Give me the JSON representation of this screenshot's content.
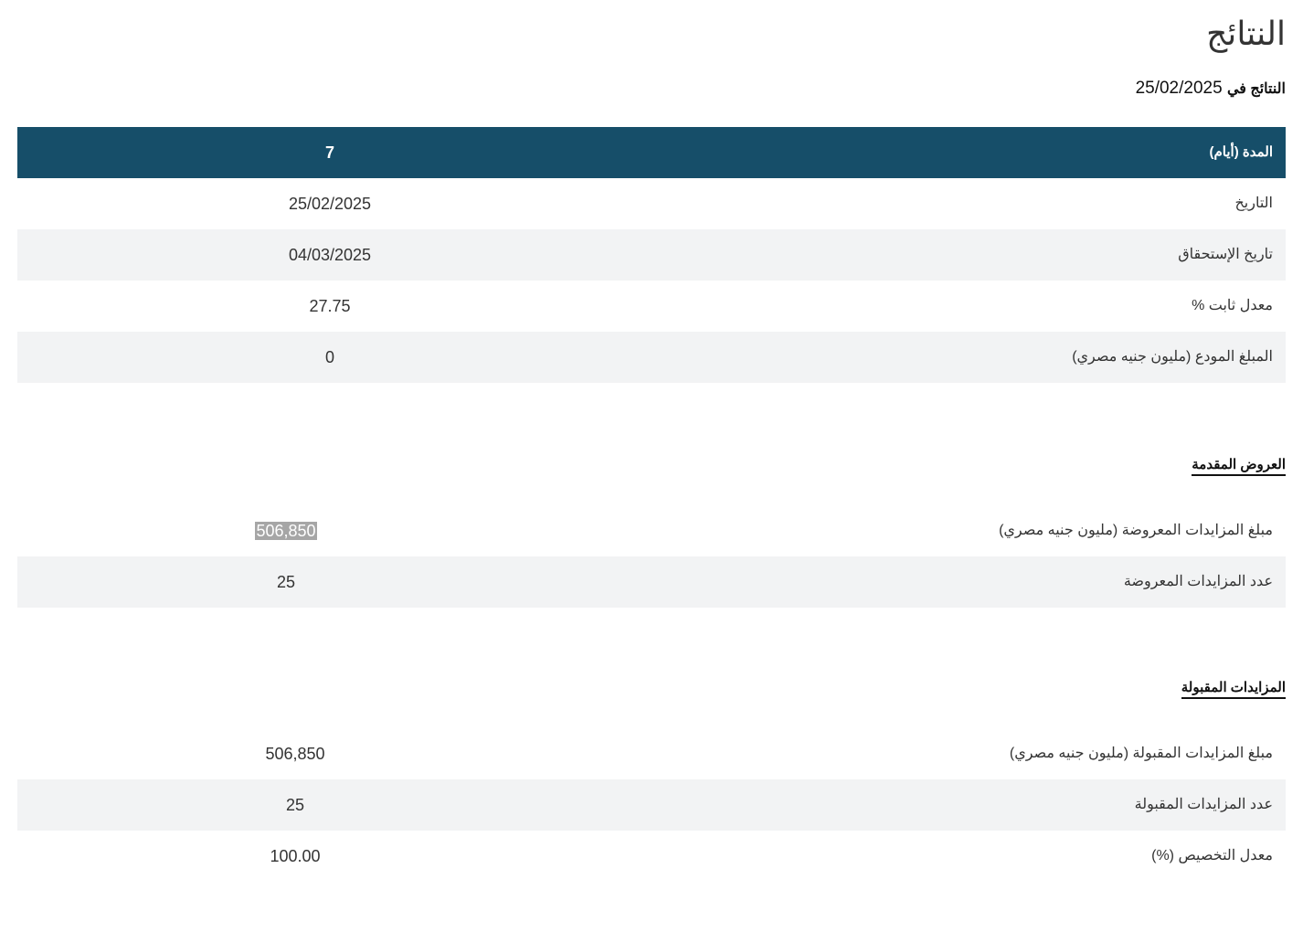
{
  "page": {
    "title": "النتائج",
    "results_date_label": "النتائج في",
    "results_date_value": "25/02/2025"
  },
  "summary_table": {
    "header": {
      "label": "المدة (أيام)",
      "value": "7"
    },
    "rows": [
      {
        "label": "التاريخ",
        "value": "25/02/2025"
      },
      {
        "label": "تاريخ الإستحقاق",
        "value": "04/03/2025"
      },
      {
        "label": "معدل ثابت %",
        "value": "27.75"
      },
      {
        "label": "المبلغ المودع (مليون جنيه مصري)",
        "value": "0"
      }
    ]
  },
  "offers_section": {
    "heading": "العروض المقدمة",
    "rows": [
      {
        "label": "مبلغ المزايدات المعروضة (مليون جنيه مصري)",
        "value": "506,850"
      },
      {
        "label": "عدد المزايدات المعروضة",
        "value": "25"
      }
    ]
  },
  "accepted_section": {
    "heading": "المزايدات المقبولة",
    "rows": [
      {
        "label": "مبلغ المزايدات المقبولة (مليون جنيه مصري)",
        "value": "506,850"
      },
      {
        "label": "عدد المزايدات المقبولة",
        "value": "25"
      },
      {
        "label": "معدل التخصيص (%)",
        "value": "100.00"
      }
    ]
  }
}
